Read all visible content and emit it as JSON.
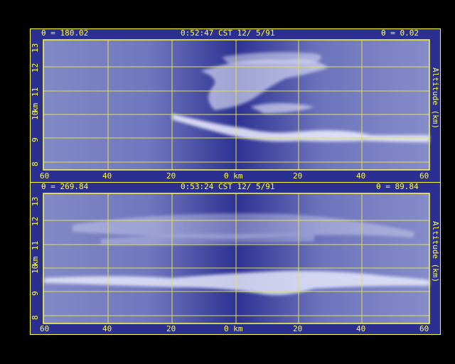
{
  "colors": {
    "frame": "#ffff40",
    "background": "#2b2f8f",
    "clouds": "#e8ecff"
  },
  "panels": [
    {
      "header_left": "θ = 180.02",
      "header_center": "0:52:47 CST 12/ 5/91",
      "header_right": "θ = 0.02",
      "x_ticks": [
        "60",
        "40",
        "20",
        "0 km",
        "20",
        "40",
        "60"
      ],
      "y_ticks": [
        "13",
        "12",
        "11",
        "10",
        "9",
        "8"
      ],
      "y_label_left": "km",
      "y_label_right": "Altitude (km)"
    },
    {
      "header_left": "θ = 269.84",
      "header_center": "0:53:24 CST 12/ 5/91",
      "header_right": "θ = 89.84",
      "x_ticks": [
        "60",
        "40",
        "20",
        "0 km",
        "20",
        "40",
        "60"
      ],
      "y_ticks": [
        "13",
        "12",
        "11",
        "10",
        "9",
        "8"
      ],
      "y_label_left": "km",
      "y_label_right": "Altitude (km)"
    }
  ]
}
